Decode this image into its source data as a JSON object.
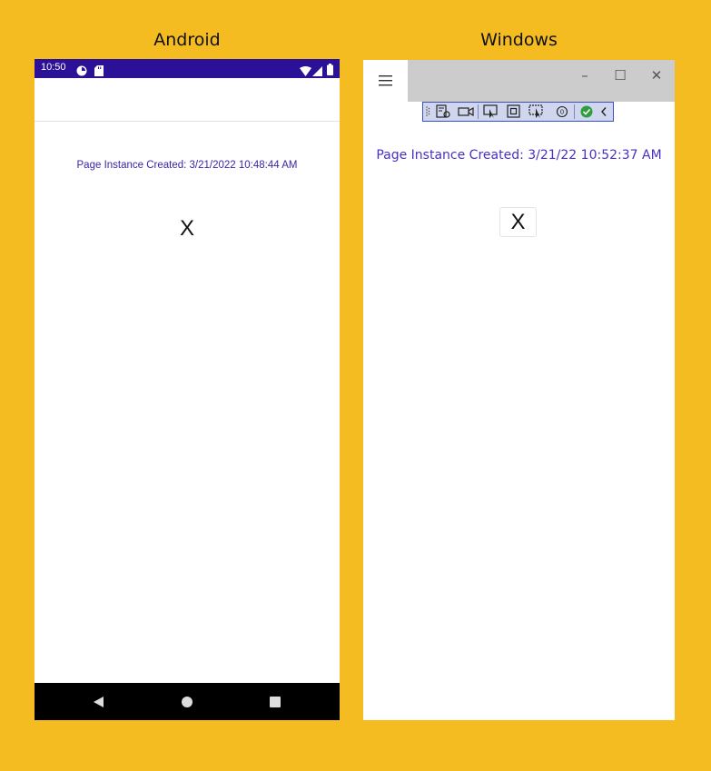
{
  "android": {
    "heading": "Android",
    "status_bar": {
      "time": "10:50",
      "color": "#2A1198"
    },
    "page_instance_created": "Page Instance Created: 3/21/2022 10:48:44 AM",
    "x_button_label": "X",
    "nav_icons": [
      "back-icon",
      "home-icon",
      "recents-icon"
    ]
  },
  "windows": {
    "heading": "Windows",
    "page_instance_created": "Page Instance Created: 3/21/22 10:52:37 AM",
    "x_button_label": "X",
    "window_controls": {
      "minimize": "–",
      "maximize": "☐",
      "close": "✕"
    },
    "toolbar_icons": [
      "live-visual-tree-icon",
      "record-icon",
      "select-element-icon",
      "display-layout-adorners-icon",
      "track-focus-icon",
      "binding-failures-icon",
      "checkmark-icon",
      "collapse-icon"
    ]
  },
  "colors": {
    "background": "#F5BC22",
    "accent_text": "#3A25A8"
  }
}
